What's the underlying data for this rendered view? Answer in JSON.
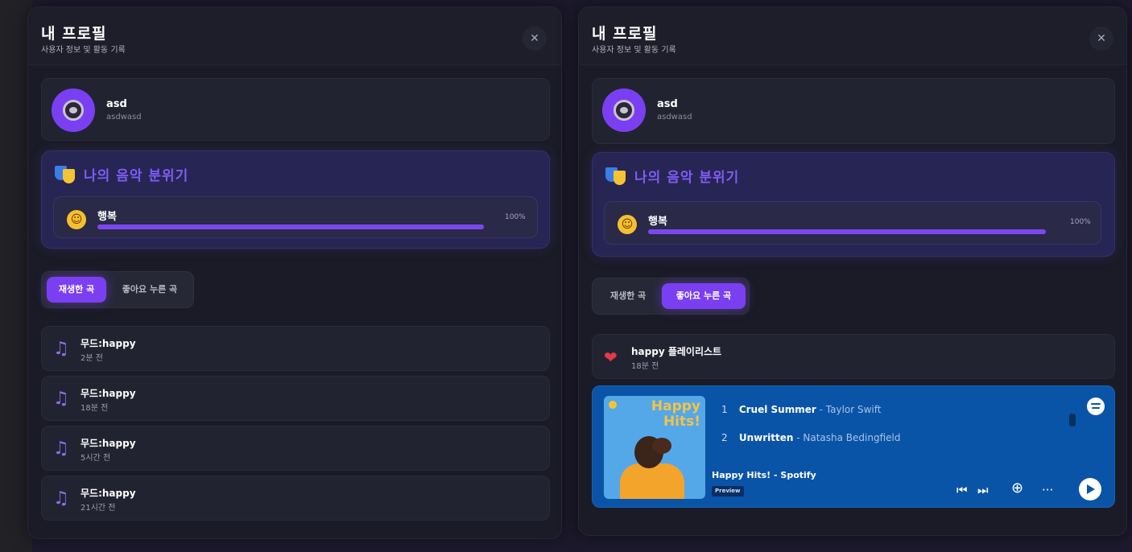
{
  "left_modal": {
    "title": "내 프로필",
    "subtitle": "사용자 정보 및 활동 기록",
    "close_glyph": "✕",
    "profile": {
      "name": "asd",
      "id": "asdwasd"
    },
    "mood_section": {
      "title": "나의 음악 분위기",
      "mood_name": "행복",
      "percent_label": "100%",
      "fill_percent": 100
    },
    "tabs": [
      {
        "label": "재생한 곡",
        "active": true
      },
      {
        "label": "좋아요 누른 곡",
        "active": false
      }
    ],
    "history": [
      {
        "title": "무드:happy",
        "time": "2분 전"
      },
      {
        "title": "무드:happy",
        "time": "18분 전"
      },
      {
        "title": "무드:happy",
        "time": "5시간 전"
      },
      {
        "title": "무드:happy",
        "time": "21시간 전"
      }
    ]
  },
  "right_modal": {
    "title": "내 프로필",
    "subtitle": "사용자 정보 및 활동 기록",
    "close_glyph": "✕",
    "profile": {
      "name": "asd",
      "id": "asdwasd"
    },
    "mood_section": {
      "title": "나의 음악 분위기",
      "mood_name": "행복",
      "percent_label": "100%",
      "fill_percent": 100
    },
    "tabs": [
      {
        "label": "재생한 곡",
        "active": false
      },
      {
        "label": "좋아요 누른 곡",
        "active": true
      }
    ],
    "liked": {
      "title": "happy 플레이리스트",
      "time": "18분 전"
    },
    "spotify_embed": {
      "cover_title": "Happy Hits!",
      "tracks": [
        {
          "num": "1",
          "name": "Cruel Summer",
          "artist": "Taylor Swift"
        },
        {
          "num": "2",
          "name": "Unwritten",
          "artist": "Natasha Bedingfield"
        }
      ],
      "playlist_name": "Happy Hits! - Spotify",
      "badge": "Preview",
      "controls": {
        "prev": "⏮",
        "next": "⏭",
        "add": "⊕",
        "more": "···"
      },
      "colors": {
        "background": "#0a54a8",
        "accent": "#f3c24a"
      }
    }
  },
  "colors": {
    "accent_purple": "#7b3ff2",
    "modal_bg": "#1a1b26",
    "heart": "#e33a4a"
  }
}
